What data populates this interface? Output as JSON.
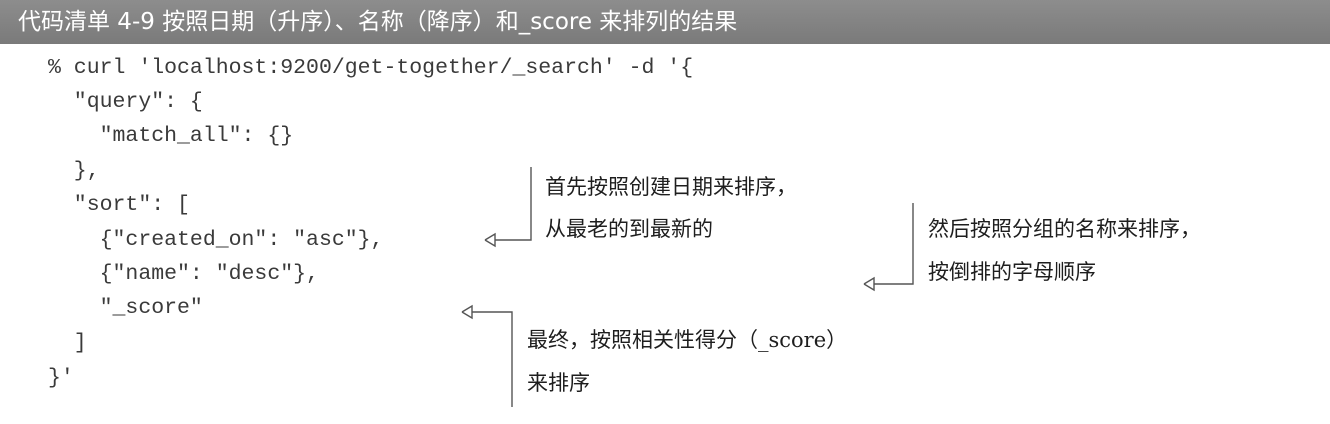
{
  "listing": {
    "title": "代码清单 4-9   按照日期（升序）、名称（降序）和_score 来排列的结果"
  },
  "code": {
    "lines": [
      "% curl 'localhost:9200/get-together/_search' -d '{",
      "  \"query\": {",
      "    \"match_all\": {}",
      "  },",
      "  \"sort\": [",
      "    {\"created_on\": \"asc\"},",
      "    {\"name\": \"desc\"},",
      "    \"_score\"",
      "  ]",
      "}'"
    ]
  },
  "annotations": {
    "created_on": {
      "line1": "首先按照创建日期来排序，",
      "line2": "从最老的到最新的"
    },
    "name": {
      "line1": "然后按照分组的名称来排序，",
      "line2": "按倒排的字母顺序"
    },
    "score": {
      "line1": "最终，按照相关性得分（_score）",
      "line2": "来排序"
    }
  },
  "colors": {
    "title_background": "#828282",
    "title_text": "#ffffff",
    "code_text": "#3a3a3a",
    "annotation_text": "#1e1e1e",
    "connector_line": "#555555"
  }
}
